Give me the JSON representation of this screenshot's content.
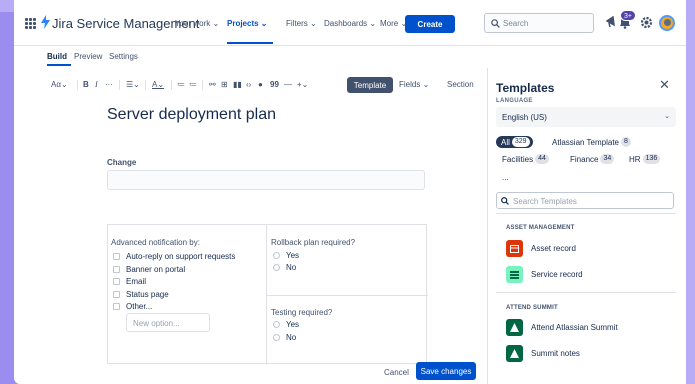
{
  "app": {
    "brand": "Jira Service Management",
    "nav": [
      "Your work",
      "Projects",
      "Filters",
      "Dashboards",
      "More"
    ],
    "active_nav": "Projects",
    "create_label": "Create",
    "search_placeholder": "Search",
    "notification_count": "3+"
  },
  "subtabs": [
    "Build",
    "Preview",
    "Settings"
  ],
  "toolbar": {
    "text_style": "Aα",
    "template_label": "Template",
    "fields_label": "Fields",
    "section_label": "Section"
  },
  "editor": {
    "title": "Server deployment plan",
    "change_label": "Change",
    "notification": {
      "title": "Advanced notification by:",
      "options": [
        "Auto-reply on support requests",
        "Banner on portal",
        "Email",
        "Status page",
        "Other..."
      ],
      "new_option_placeholder": "New option..."
    },
    "rollback": {
      "title": "Rollback plan required?",
      "options": [
        "Yes",
        "No"
      ]
    },
    "testing": {
      "title": "Testing required?",
      "options": [
        "Yes",
        "No"
      ]
    },
    "cancel_label": "Cancel",
    "save_label": "Save changes"
  },
  "templates_panel": {
    "title": "Templates",
    "language_label": "LANGUAGE",
    "language_value": "English (US)",
    "chips": [
      {
        "label": "All",
        "count": "329",
        "selected": true
      },
      {
        "label": "Atlassian Template",
        "count": "8"
      },
      {
        "label": "Facilities",
        "count": "44"
      },
      {
        "label": "Finance",
        "count": "34"
      },
      {
        "label": "HR",
        "count": "136"
      },
      {
        "label": "..."
      }
    ],
    "search_placeholder": "Search Templates",
    "categories": [
      {
        "name": "ASSET MANAGEMENT",
        "items": [
          {
            "label": "Asset record",
            "color": "#de350b"
          },
          {
            "label": "Service record",
            "color": "#79f2c0"
          }
        ]
      },
      {
        "name": "ATTEND SUMMIT",
        "items": [
          {
            "label": "Attend Atlassian Summit",
            "color": "#006644"
          },
          {
            "label": "Summit notes",
            "color": "#006644"
          }
        ]
      }
    ]
  },
  "colors": {
    "primary": "#0052cc",
    "background": "#9b8cf0"
  }
}
